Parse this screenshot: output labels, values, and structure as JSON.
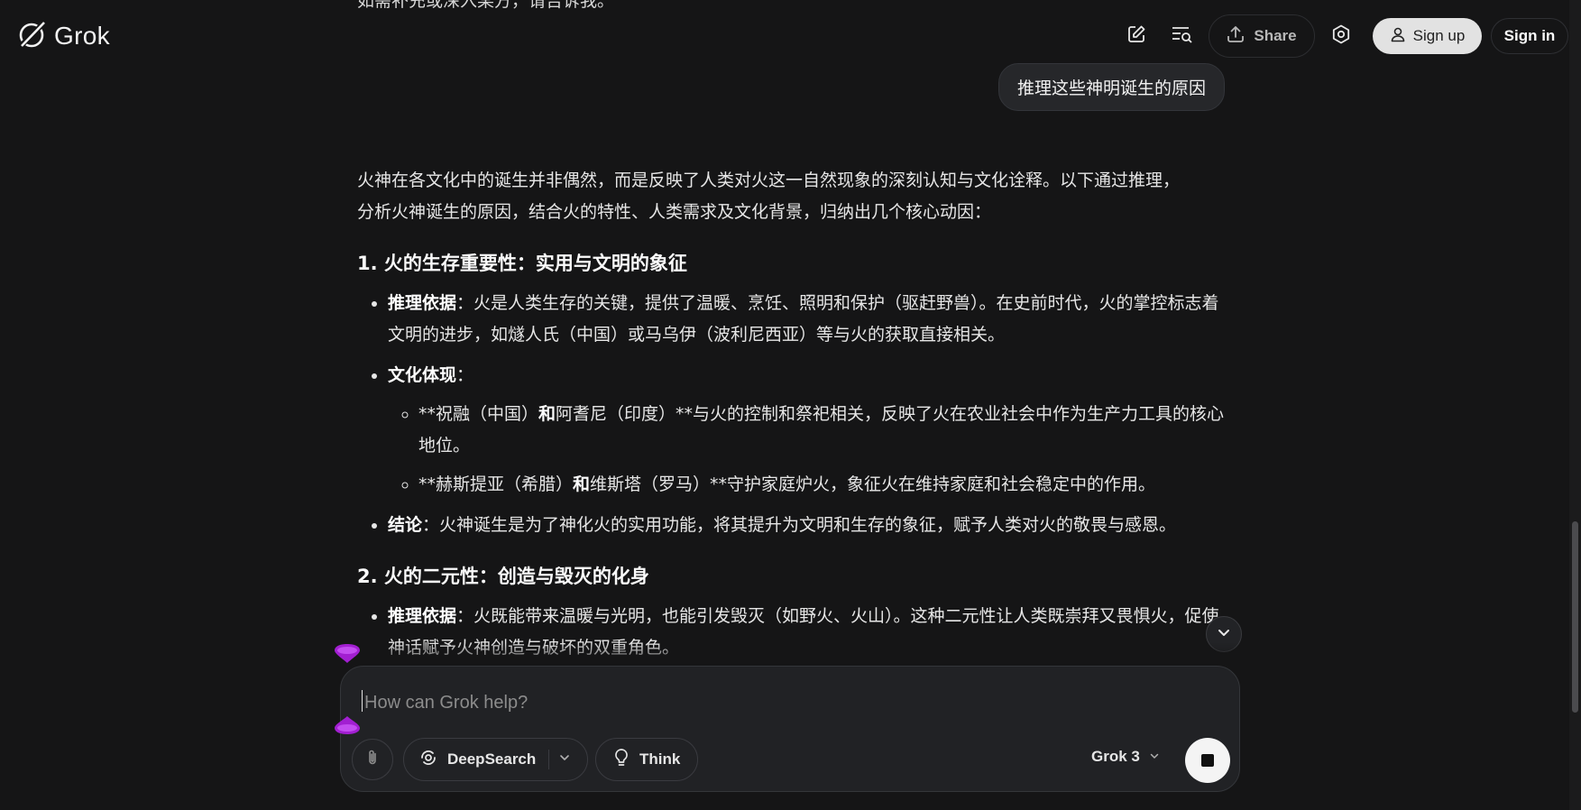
{
  "header": {
    "brand": "Grok",
    "share_label": "Share",
    "signup_label": "Sign up",
    "signin_label": "Sign in"
  },
  "conversation": {
    "previous_line_fragment": "如需补充或深入某方，请告诉我。",
    "user_message": "推理这些神明诞生的原因",
    "answer": {
      "intro_line1": "火神在各文化中的诞生并非偶然，而是反映了人类对火这一自然现象的深刻认知与文化诠释。以下通过推理，",
      "intro_line2": "分析火神诞生的原因，结合火的特性、人类需求及文化背景，归纳出几个核心动因：",
      "section1": {
        "heading": "1. 火的生存重要性：实用与文明的象征",
        "b1_label": "推理依据",
        "b1_text": "：火是人类生存的关键，提供了温暖、烹饪、照明和保护（驱赶野兽）。在史前时代，火的掌控标志着文明的进步，如燧人氏（中国）或马乌伊（波利尼西亚）等与火的获取直接相关。",
        "b2_label": "文化体现",
        "b2_text": "：",
        "sub1_a": "**祝融（中国）",
        "sub1_and": "和",
        "sub1_b": "阿耆尼（印度）**与火的控制和祭祀相关，反映了火在农业社会中作为生产力工具的核心地位。",
        "sub2_a": "**赫斯提亚（希腊）",
        "sub2_and": "和",
        "sub2_b": "维斯塔（罗马）**守护家庭炉火，象征火在维持家庭和社会稳定中的作用。",
        "b3_label": "结论",
        "b3_text": "：火神诞生是为了神化火的实用功能，将其提升为文明和生存的象征，赋予人类对火的敬畏与感恩。"
      },
      "section2": {
        "heading": "2. 火的二元性：创造与毁灭的化身",
        "b1_label": "推理依据",
        "b1_text": "：火既能带来温暖与光明，也能引发毁灭（如野火、火山）。这种二元性让人类既崇拜又畏惧火，促使神话赋予火神创造与破坏的双重角色。"
      }
    }
  },
  "composer": {
    "placeholder": "How can Grok help?",
    "deepsearch_label": "DeepSearch",
    "think_label": "Think",
    "model_label": "Grok 3"
  },
  "colors": {
    "background": "#151516",
    "bubble": "#26272a",
    "composer": "#212225",
    "accent_purple": "#a21fd1"
  },
  "icons": [
    "grok-logo-icon",
    "new-chat-icon",
    "history-search-icon",
    "share-icon",
    "settings-icon",
    "user-icon",
    "chevron-down-icon",
    "paperclip-icon",
    "deepsearch-icon",
    "lightbulb-icon",
    "stop-icon"
  ]
}
